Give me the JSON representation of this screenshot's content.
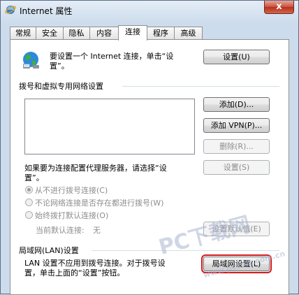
{
  "window": {
    "title": "Internet 属性",
    "close_glyph": "x"
  },
  "tabs": [
    {
      "label": "常规"
    },
    {
      "label": "安全"
    },
    {
      "label": "隐私"
    },
    {
      "label": "内容"
    },
    {
      "label": "连接"
    },
    {
      "label": "程序"
    },
    {
      "label": "高级"
    }
  ],
  "active_tab": "连接",
  "setup": {
    "text_line1": "要设置一个 Internet 连接，单击“设",
    "text_line2": "置”。",
    "button": "设置(U)"
  },
  "dialup": {
    "group_label": "拨号和虚拟专用网络设置",
    "add_button": "添加(D)...",
    "add_vpn_button": "添加 VPN(P)...",
    "delete_button": "删除(R)...",
    "proxy_text_line1": "如果要为连接配置代理服务器，请选择“设",
    "proxy_text_line2": "置”。",
    "settings_button": "设置(S)",
    "options": [
      {
        "label": "从不进行拨号连接(C)",
        "checked": true
      },
      {
        "label": "不论网络连接是否存在都进行拨号(W)",
        "checked": false
      },
      {
        "label": "始终拨打默认连接(O)",
        "checked": false
      }
    ],
    "current_default_label": "当前默认连接:",
    "current_default_value": "无",
    "set_default_button": "设置默认值(E)"
  },
  "lan": {
    "group_label": "局域网(LAN)设置",
    "text_line1": "LAN 设置不应用到拨号连接。对于拨号设",
    "text_line2": "置，单击上面的“设置”按钮。",
    "button": "局域网设置(L)"
  },
  "watermark": {
    "brand": "PC下载网",
    "site": "www.pcsoft.com.cn"
  }
}
